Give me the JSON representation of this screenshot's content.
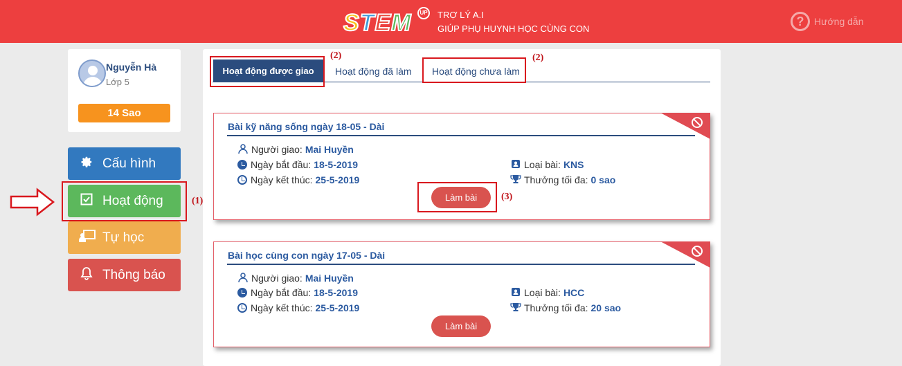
{
  "header": {
    "logo_text": "STEM",
    "logo_badge": "UP",
    "tagline_1": "TRỢ LÝ A.I",
    "tagline_2": "GIÚP PHỤ HUYNH HỌC CÙNG CON",
    "help_label": "Hướng dẫn",
    "help_icon": "?"
  },
  "profile": {
    "name": "Nguyễn Hà",
    "class": "Lớp 5",
    "stars": "14 Sao"
  },
  "sidebar": {
    "items": [
      {
        "label": "Cấu hình",
        "icon": "gear-icon"
      },
      {
        "label": "Hoạt động",
        "icon": "checkbox-icon"
      },
      {
        "label": "Tự học",
        "icon": "teacher-board-icon"
      },
      {
        "label": "Thông báo",
        "icon": "bell-icon"
      }
    ]
  },
  "tabs": [
    {
      "label": "Hoạt động được giao",
      "active": true
    },
    {
      "label": "Hoạt động đã làm"
    },
    {
      "label": "Hoạt động chưa làm"
    }
  ],
  "annotations": {
    "a1": "(1)",
    "a2a": "(2)",
    "a2b": "(2)",
    "a3": "(3)"
  },
  "cards": [
    {
      "title": "Bài kỹ năng sống ngày 18-05 - Dài",
      "giver_label": "Người giao:",
      "giver": "Mai Huyền",
      "start_label": "Ngày bắt đầu:",
      "start": "18-5-2019",
      "end_label": "Ngày kết thúc:",
      "end": "25-5-2019",
      "type_label": "Loại bài:",
      "type": "KNS",
      "reward_label": "Thưởng tối đa:",
      "reward": "0 sao",
      "button": "Làm bài"
    },
    {
      "title": "Bài học cùng con ngày 17-05 - Dài",
      "giver_label": "Người giao:",
      "giver": "Mai Huyền",
      "start_label": "Ngày bắt đầu:",
      "start": "18-5-2019",
      "end_label": "Ngày kết thúc:",
      "end": "25-5-2019",
      "type_label": "Loại bài:",
      "type": "HCC",
      "reward_label": "Thưởng tối đa:",
      "reward": "20 sao",
      "button": "Làm bài"
    }
  ],
  "colors": {
    "header": "#ed3f3f",
    "primary": "#2b4c7e",
    "config": "#3279bf",
    "activity": "#5cb85c",
    "self_study": "#f0ad4e",
    "notify": "#d9534f"
  }
}
